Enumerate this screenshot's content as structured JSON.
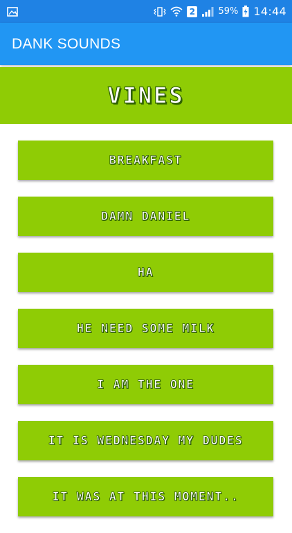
{
  "status_bar": {
    "battery": "59%",
    "sim_badge": "2",
    "time": "14:44",
    "icons": [
      "image-icon",
      "vibrate-icon",
      "wifi-icon",
      "sim-2-icon",
      "signal-icon",
      "battery-charging-icon"
    ]
  },
  "app_bar": {
    "title": "DANK SOUNDS"
  },
  "header": {
    "heading": "VINES"
  },
  "sounds": [
    {
      "label": "BREAKFAST"
    },
    {
      "label": "DAMN DANIEL"
    },
    {
      "label": "HA"
    },
    {
      "label": "HE NEED SOME MILK"
    },
    {
      "label": "I AM THE ONE"
    },
    {
      "label": "IT IS WEDNESDAY MY DUDES"
    },
    {
      "label": "IT WAS AT THIS MOMENT.."
    }
  ],
  "colors": {
    "status_bar": "#1f82e4",
    "app_bar": "#2196f3",
    "accent_green": "#8fcc05",
    "text_outline": "#2f6100"
  }
}
